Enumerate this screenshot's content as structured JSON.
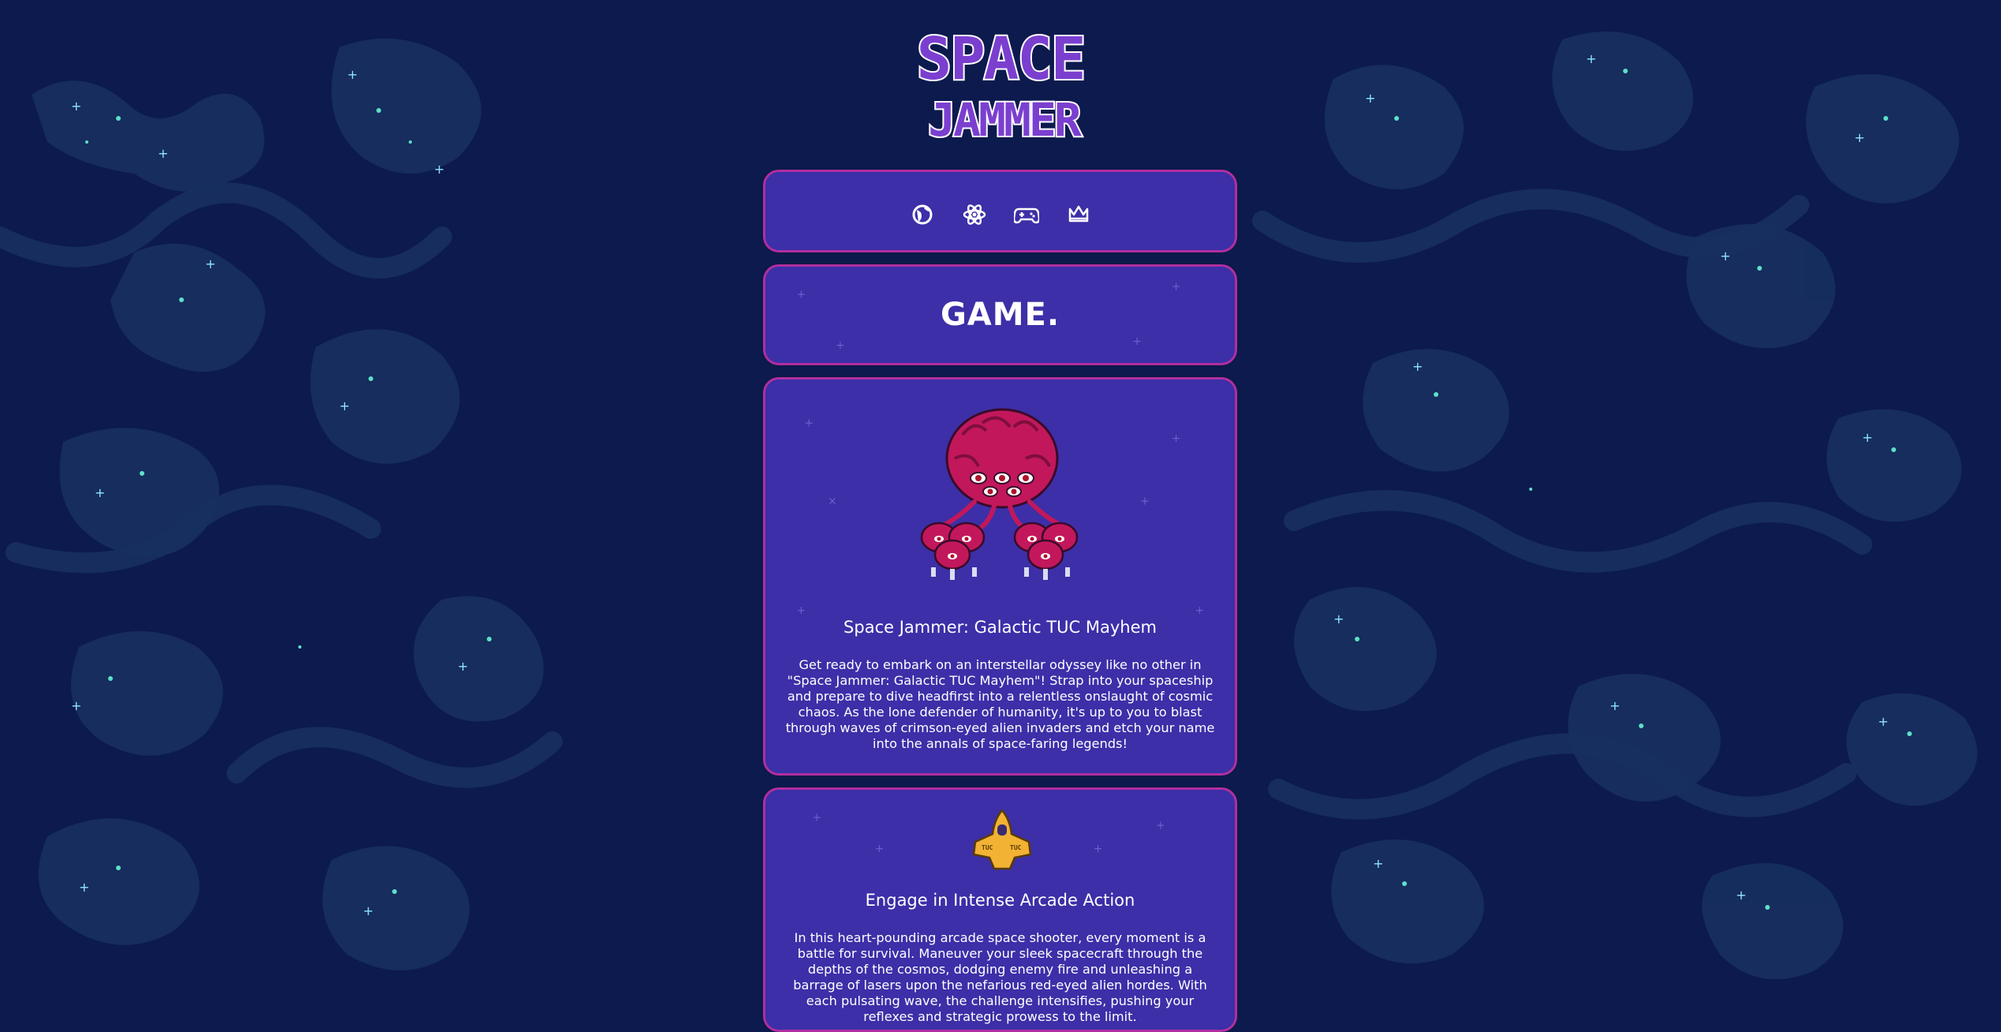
{
  "logo": {
    "line1": "SPACE",
    "line2": "JAMMER"
  },
  "nav": {
    "items": [
      {
        "icon": "planet-icon",
        "label": ""
      },
      {
        "icon": "atom-icon",
        "label": ""
      },
      {
        "icon": "gamepad-icon",
        "label": ""
      },
      {
        "icon": "crown-icon",
        "label": ""
      }
    ]
  },
  "page_title": "GAME.",
  "cards": [
    {
      "image": "alien-horde-sprite",
      "title": "Space Jammer: Galactic TUC Mayhem",
      "text": "Get ready to embark on an interstellar odyssey like no other in \"Space Jammer: Galactic TUC Mayhem\"! Strap into your spaceship and prepare to dive headfirst into a relentless onslaught of cosmic chaos. As the lone defender of humanity, it's up to you to blast through waves of crimson-eyed alien invaders and etch your name into the annals of space-faring legends!"
    },
    {
      "image": "spaceship-sprite",
      "ship_badge": "TUC",
      "title": "Engage in Intense Arcade Action",
      "text": "In this heart-pounding arcade space shooter, every moment is a battle for survival. Maneuver your sleek spacecraft through the depths of the cosmos, dodging enemy fire and unleashing a barrage of lasers upon the nefarious red-eyed alien hordes. With each pulsating wave, the challenge intensifies, pushing your reflexes and strategic prowess to the limit."
    }
  ],
  "colors": {
    "background": "#0c1a4d",
    "nebula": "#17305f",
    "panel": "#3c2fa8",
    "panel_border": "#b02ea0",
    "logo_fill": "#7b3fd0",
    "alien": "#c2185b",
    "ship": "#f2b233"
  }
}
